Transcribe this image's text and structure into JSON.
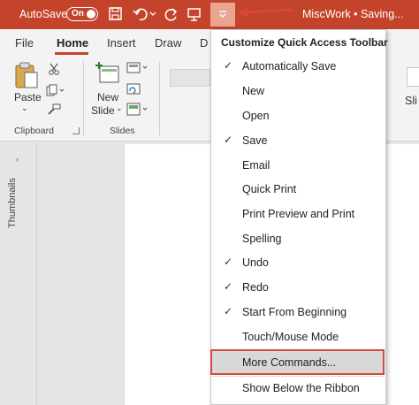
{
  "titlebar": {
    "autosave_label": "AutoSave",
    "autosave_state": "On",
    "document_title": "MiscWork • Saving...",
    "icons": [
      "save-icon",
      "undo-icon",
      "redo-icon",
      "present-from-beginning-icon",
      "customize-qat-dropdown-icon"
    ],
    "accent_color": "#c4442b",
    "callout_color": "#d9473c"
  },
  "ribbon_tabs": [
    "File",
    "Home",
    "Insert",
    "Draw",
    "D"
  ],
  "ribbon": {
    "clipboard": {
      "paste_label": "Paste",
      "group_label": "Clipboard"
    },
    "slides": {
      "new_slide_line1": "New",
      "new_slide_line2": "Slide",
      "group_label": "Slides"
    },
    "cutoff_tab_text": "Sli"
  },
  "thumbnails_label": "Thumbnails",
  "menu": {
    "header": "Customize Quick Access Toolbar",
    "items": [
      {
        "label": "Automatically Save",
        "checked": "✓"
      },
      {
        "label": "New",
        "checked": ""
      },
      {
        "label": "Open",
        "checked": ""
      },
      {
        "label": "Save",
        "checked": "✓"
      },
      {
        "label": "Email",
        "checked": ""
      },
      {
        "label": "Quick Print",
        "checked": ""
      },
      {
        "label": "Print Preview and Print",
        "checked": ""
      },
      {
        "label": "Spelling",
        "checked": ""
      },
      {
        "label": "Undo",
        "checked": "✓"
      },
      {
        "label": "Redo",
        "checked": "✓"
      },
      {
        "label": "Start From Beginning",
        "checked": "✓"
      },
      {
        "label": "Touch/Mouse Mode",
        "checked": ""
      },
      {
        "label": "More Commands...",
        "checked": ""
      },
      {
        "label": "Show Below the Ribbon",
        "checked": ""
      }
    ]
  }
}
